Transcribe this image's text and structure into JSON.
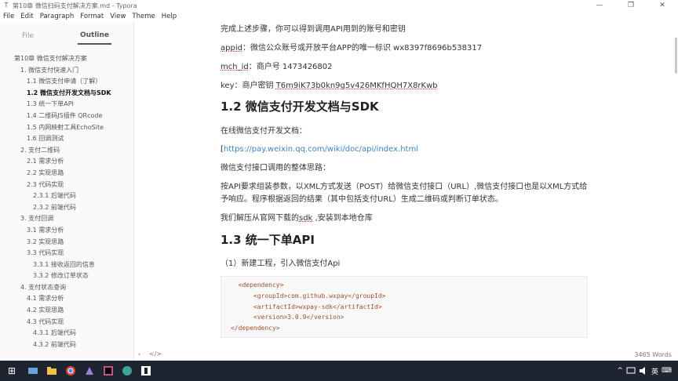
{
  "window": {
    "title": "第10章 微信扫码支付解决方案.md - Typora",
    "minimize": "—",
    "maximize": "❐",
    "close": "✕"
  },
  "menu": [
    "File",
    "Edit",
    "Paragraph",
    "Format",
    "View",
    "Theme",
    "Help"
  ],
  "sidebar": {
    "tab_file": "File",
    "tab_outline": "Outline",
    "toc": [
      {
        "text": "第10章 微信支付解决方案",
        "level": 1,
        "current": false
      },
      {
        "text": "1. 微信支付快速入门",
        "level": 2,
        "current": false
      },
      {
        "text": "1.1 微信支付申请（了解）",
        "level": 3,
        "current": false
      },
      {
        "text": "1.2 微信支付开发文档与SDK",
        "level": 3,
        "current": true
      },
      {
        "text": "1.3 统一下单API",
        "level": 3,
        "current": false
      },
      {
        "text": "1.4 二维码JS插件 QRcode",
        "level": 3,
        "current": false
      },
      {
        "text": "1.5 内网映射工具EchoSite",
        "level": 3,
        "current": false
      },
      {
        "text": "1.6 回调测试",
        "level": 3,
        "current": false
      },
      {
        "text": "2. 支付二维码",
        "level": 2,
        "current": false
      },
      {
        "text": "2.1 需求分析",
        "level": 3,
        "current": false
      },
      {
        "text": "2.2 实现思路",
        "level": 3,
        "current": false
      },
      {
        "text": "2.3 代码实现",
        "level": 3,
        "current": false
      },
      {
        "text": "2.3.1 后端代码",
        "level": 4,
        "current": false
      },
      {
        "text": "2.3.2 前端代码",
        "level": 4,
        "current": false
      },
      {
        "text": "3. 支付回调",
        "level": 2,
        "current": false
      },
      {
        "text": "3.1 需求分析",
        "level": 3,
        "current": false
      },
      {
        "text": "3.2 实现思路",
        "level": 3,
        "current": false
      },
      {
        "text": "3.3 代码实现",
        "level": 3,
        "current": false
      },
      {
        "text": "3.3.1 接收返回的信息",
        "level": 4,
        "current": false
      },
      {
        "text": "3.3.2 修改订单状态",
        "level": 4,
        "current": false
      },
      {
        "text": "4. 支付状态查询",
        "level": 2,
        "current": false
      },
      {
        "text": "4.1 需求分析",
        "level": 3,
        "current": false
      },
      {
        "text": "4.2 实现思路",
        "level": 3,
        "current": false
      },
      {
        "text": "4.3 代码实现",
        "level": 3,
        "current": false
      },
      {
        "text": "4.3.1 后端代码",
        "level": 4,
        "current": false
      },
      {
        "text": "4.3.2 前端代码",
        "level": 4,
        "current": false
      }
    ],
    "footer_collapse": "‹",
    "footer_source": "</>"
  },
  "doc": {
    "p_intro": "完成上述步骤，你可以得到调用API用到的账号和密钥",
    "appid_key": "appid",
    "appid_text": "：微信公众账号或开放平台APP的唯一标识  wx8397f8696b538317",
    "mchid_key": "mch_id",
    "mchid_text": "：商户号  1473426802",
    "key_text": "key：商户密钥   ",
    "key_value": "T6m9iK73b0kn9g5v426MKfHQH7X8rKwb",
    "h_12": "1.2 微信支付开发文档与SDK",
    "p_doc_online": "在线微信支付开发文档：",
    "link_prefix": "[",
    "link_url": "https://pay.weixin.qq.com/wiki/doc/api/index.html",
    "p_flow_title": "微信支付接口调用的整体思路：",
    "p_flow_1": "按API要求组装参数，以XML方式发送（POST）给微信支付接口（URL）,微信支付接口也是以XML方式给",
    "p_flow_2": "予响应。程序根据返回的结果（其中包括支付URL）生成二维码或判断订单状态。",
    "p_sdk_1": "我们解压从官网下载的",
    "p_sdk_word": "sdk",
    "p_sdk_2": " ,安装到本地仓库",
    "h_13": "1.3 统一下单API",
    "p_step1": "（1）新建工程，引入微信支付Api",
    "code": [
      "  <dependency>",
      "      <groupId>com.github.wxpay</groupId>",
      "      <artifactId>wxpay-sdk</artifactId>",
      "      <version>3.0.9</version>",
      "</dependency>"
    ]
  },
  "status": {
    "word_count": "3465 Words"
  },
  "taskbar": {
    "start": "⊞",
    "tray_up": "^",
    "tray_lang": "英",
    "tray_ime": "⌨"
  },
  "colors": {
    "accent_link": "#4183c4",
    "taskbar": "#1f2530",
    "code_text": "#a0522d"
  }
}
